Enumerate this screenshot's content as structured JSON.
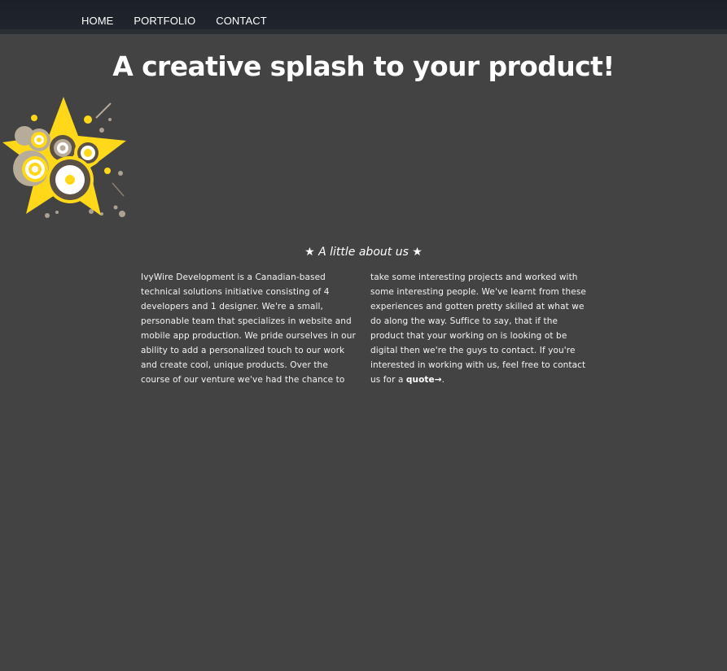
{
  "nav": {
    "items": [
      "HOME",
      "PORTFOLIO",
      "CONTACT"
    ]
  },
  "hero": {
    "headline": "A creative splash to your product!"
  },
  "about": {
    "title": "★ A little about us ★",
    "left_text": "IvyWire Development is a Canadian-based technical solutions initiative consisting of 4 developers and 1 designer. We're a small, personable team that specializes in website and mobile app production. We pride ourselves in our ability to add a personalized touch to our work and create cool, unique products. Over the course of our venture we've had the chance to",
    "right_text_before": "take some interesting projects and worked with some interesting people. We've learnt from these experiences and gotten pretty skilled at what we do along the way. Suffice to say, that if the product that your working on is looking ot be digital then we're the guys to contact. If you're interested in working with us, feel free to contact us for a ",
    "quote_link": "quote→",
    "right_text_after": "."
  },
  "colors": {
    "background": "#434343",
    "topbar": "#1c2028",
    "logo_yellow": "#ffd81a",
    "logo_dark": "#5a5046",
    "logo_beige": "#b7ab9a"
  },
  "logo": {
    "icon": "star-splash-logo-icon"
  }
}
